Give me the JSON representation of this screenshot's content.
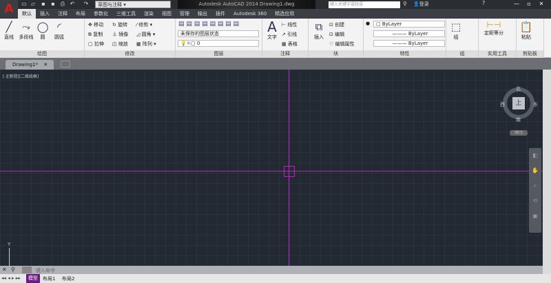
{
  "app": {
    "logo": "A",
    "title": "Autodesk AutoCAD 2014    Drawing1.dwg",
    "workspace": "草图与注释",
    "search_placeholder": "键入关键字或短语",
    "login": "登录"
  },
  "quick_access": [
    "new-icon",
    "open-icon",
    "save-icon",
    "saveas-icon",
    "print-icon",
    "undo-icon",
    "redo-icon"
  ],
  "tabs": [
    "默认",
    "插入",
    "注释",
    "布局",
    "参数化",
    "三维工具",
    "渲染",
    "视图",
    "管理",
    "输出",
    "插件",
    "Autodesk 360",
    "精选应用"
  ],
  "ribbon": {
    "draw": {
      "title": "绘图",
      "tools": [
        "直线",
        "多段线",
        "圆",
        "圆弧"
      ]
    },
    "modify": {
      "title": "修改",
      "tools": [
        "移动",
        "旋转",
        "修剪",
        "复制",
        "镜像",
        "圆角",
        "拉伸",
        "缩放",
        "阵列"
      ]
    },
    "layers": {
      "title": "图层",
      "state": "未保存的图层状态",
      "layer": "0"
    },
    "annotation": {
      "title": "注释",
      "tools": [
        "文字",
        "线性",
        "引线",
        "表格"
      ]
    },
    "block": {
      "title": "块",
      "tools": [
        "插入",
        "创建",
        "编辑",
        "编辑属性"
      ]
    },
    "properties": {
      "title": "特性",
      "color": "ByLayer",
      "linetype": "ByLayer",
      "lineweight": "ByLayer"
    },
    "group": {
      "title": "组",
      "tools": [
        "组"
      ]
    },
    "utilities": {
      "title": "实用工具",
      "tools": [
        "定距等分"
      ]
    },
    "clipboard": {
      "title": "剪贴板",
      "tools": [
        "粘贴"
      ]
    }
  },
  "file_tab": "Drawing1*",
  "viewport": {
    "label": "[-][俯视][二维线框]",
    "compass": {
      "n": "北",
      "s": "南",
      "e": "东",
      "w": "西",
      "top": "上"
    },
    "ucs": "WCS",
    "axis_y": "Y"
  },
  "command": {
    "placeholder": "键入命令"
  },
  "layout_tabs": [
    "模型",
    "布局1",
    "布局2"
  ],
  "colors": {
    "crosshair": "#c020c0",
    "canvas": "#222933",
    "accent": "#d21f1f"
  }
}
